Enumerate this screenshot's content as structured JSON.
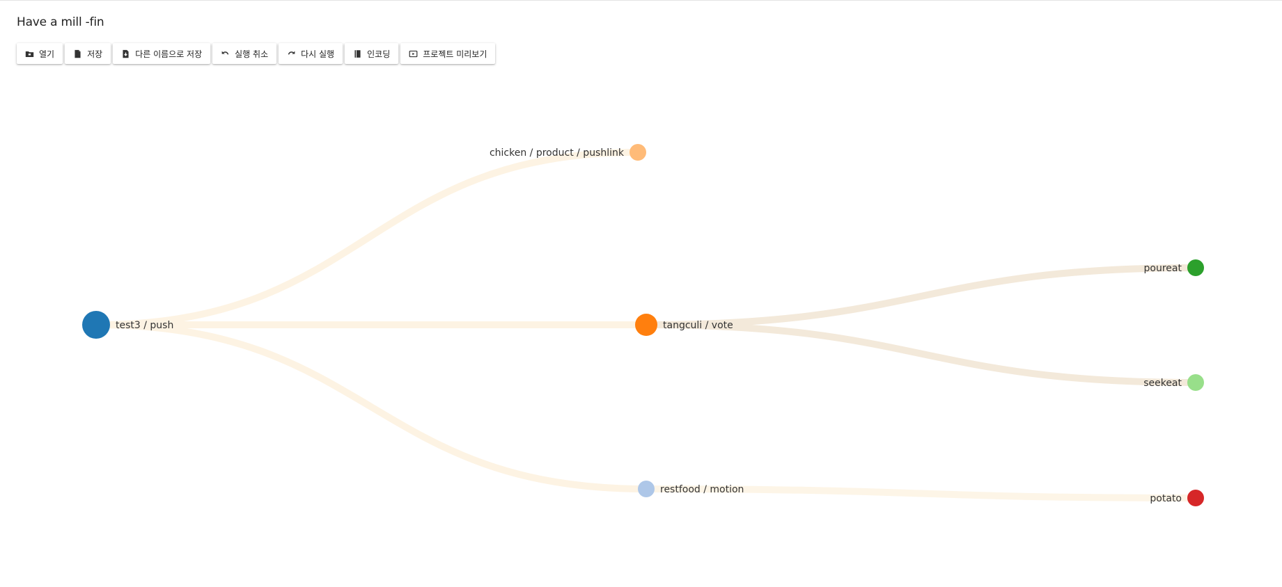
{
  "window": {
    "title": "Have a mill -fin"
  },
  "toolbar": {
    "buttons": [
      {
        "icon": "folder-open-icon",
        "label": "열기"
      },
      {
        "icon": "file-icon",
        "label": "저장"
      },
      {
        "icon": "file-download-icon",
        "label": "다른 이름으로 저장"
      },
      {
        "icon": "undo-icon",
        "label": "실행 취소"
      },
      {
        "icon": "redo-icon",
        "label": "다시 실행"
      },
      {
        "icon": "book-icon",
        "label": "인코딩"
      },
      {
        "icon": "preview-icon",
        "label": "프로젝트 미리보기"
      }
    ]
  },
  "tree": {
    "link_colors": {
      "root": "#fdf3e3",
      "tangculi": "#f3e9da",
      "restfood": "#fdf5e7"
    },
    "nodes": [
      {
        "id": "root",
        "label": "test3 / push",
        "color": "#1f77b4",
        "size": "large",
        "label_side": "right"
      },
      {
        "id": "chicken",
        "label": "chicken / product / pushlink",
        "color": "#ffbb78",
        "size": "small",
        "label_side": "left",
        "parent": "root"
      },
      {
        "id": "tangculi",
        "label": "tangculi / vote",
        "color": "#ff7f0e",
        "size": "medium",
        "label_side": "right",
        "parent": "root"
      },
      {
        "id": "restfood",
        "label": "restfood / motion",
        "color": "#aec7e8",
        "size": "small",
        "label_side": "right",
        "parent": "root"
      },
      {
        "id": "poureat",
        "label": "poureat",
        "color": "#2ca02c",
        "size": "small",
        "label_side": "left",
        "parent": "tangculi"
      },
      {
        "id": "seekeat",
        "label": "seekeat",
        "color": "#98df8a",
        "size": "small",
        "label_side": "left",
        "parent": "tangculi"
      },
      {
        "id": "potato",
        "label": "potato",
        "color": "#d62728",
        "size": "small",
        "label_side": "left",
        "parent": "restfood"
      }
    ]
  }
}
